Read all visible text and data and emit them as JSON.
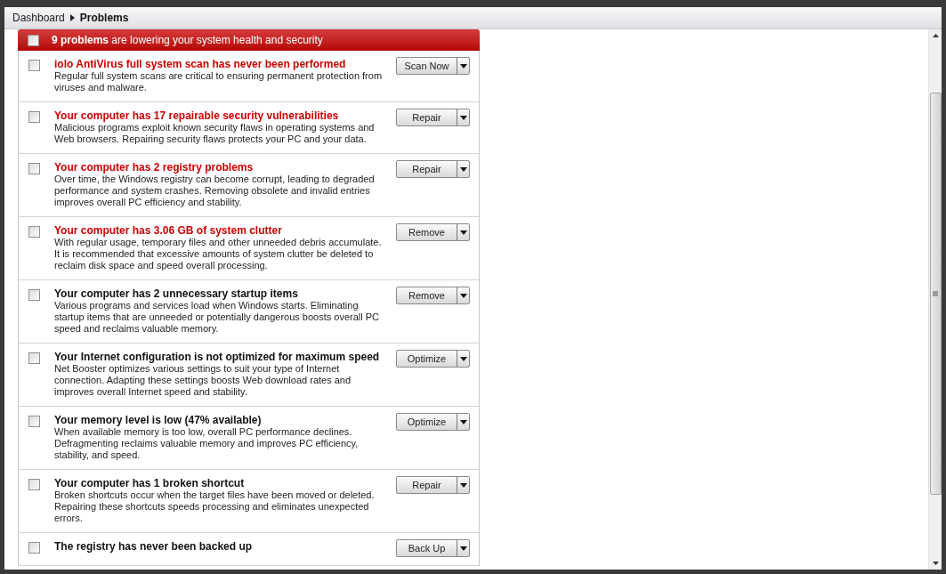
{
  "breadcrumb": {
    "items": [
      "Dashboard"
    ],
    "current": "Problems"
  },
  "header": {
    "checked": false,
    "text": "**9 problems** are lowering your system health and security"
  },
  "problems": [
    {
      "checked": false,
      "severe": true,
      "title": "iolo AntiVirus full system scan has never been performed",
      "description": "Regular full system scans are critical to ensuring permanent protection from viruses and malware.",
      "action": "Scan Now"
    },
    {
      "checked": false,
      "severe": true,
      "title": "Your computer has 17 repairable security vulnerabilities",
      "description": "Malicious programs exploit known security flaws in operating systems and Web browsers. Repairing security flaws protects your PC and your data.",
      "action": "Repair"
    },
    {
      "checked": false,
      "severe": true,
      "title": "Your computer has 2 registry problems",
      "description": "Over time, the Windows registry can become corrupt, leading to degraded performance and system crashes. Removing obsolete and invalid entries improves overall PC efficiency and stability.",
      "action": "Repair"
    },
    {
      "checked": false,
      "severe": true,
      "title": "Your computer has 3.06 GB of system clutter",
      "description": "With regular usage, temporary files and other unneeded debris accumulate. It is recommended that excessive amounts of system clutter be deleted to reclaim disk space and speed overall processing.",
      "action": "Remove"
    },
    {
      "checked": false,
      "severe": false,
      "title": "Your computer has 2 unnecessary startup items",
      "description": "Various programs and services load when Windows starts. Eliminating startup items that are unneeded or potentially dangerous boosts overall PC speed and reclaims valuable memory.",
      "action": "Remove"
    },
    {
      "checked": false,
      "severe": false,
      "title": "Your Internet configuration is not optimized for maximum speed",
      "description": "Net Booster optimizes various settings to suit your type of Internet connection. Adapting these settings boosts Web download rates and improves overall Internet speed and stability.",
      "action": "Optimize"
    },
    {
      "checked": false,
      "severe": false,
      "title": "Your memory level is low (47% available)",
      "description": "When available memory is too low, overall PC performance declines. Defragmenting reclaims valuable memory and improves PC efficiency, stability, and speed.",
      "action": "Optimize"
    },
    {
      "checked": false,
      "severe": false,
      "title": "Your computer has 1 broken shortcut",
      "description": "Broken shortcuts occur when the target files have been moved or deleted. Repairing these shortcuts speeds processing and eliminates unexpected errors.",
      "action": "Repair"
    },
    {
      "checked": false,
      "severe": false,
      "title": "The registry has never been backed up",
      "action": "Back Up"
    }
  ]
}
